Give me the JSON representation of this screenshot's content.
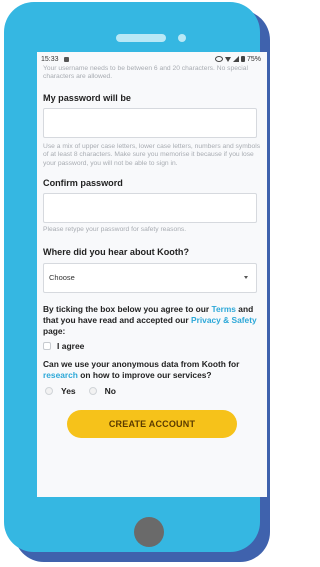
{
  "status_bar": {
    "time": "15:33",
    "battery": "75%"
  },
  "form": {
    "username_hint": "Your username needs to be between 6 and 20 characters. No special characters are allowed.",
    "password_label": "My password will be",
    "password_hint": "Use a mix of upper case letters, lower case letters, numbers and symbols of at least 8 characters. Make sure you memorise it because if you lose your password, you will not be able to sign in.",
    "confirm_label": "Confirm password",
    "confirm_hint": "Please retype your password for safety reasons.",
    "hear_label": "Where did you hear about Kooth?",
    "hear_select_value": "Choose",
    "terms_text_1": "By ticking the box below you agree to our ",
    "terms_link": "Terms",
    "terms_text_2": " and that you have read and accepted our ",
    "privacy_link": "Privacy & Safety",
    "terms_text_3": " page:",
    "agree_label": "I agree",
    "data_text_1": "Can we use your anonymous data from Kooth for ",
    "research_link": "research",
    "data_text_2": " on how to improve our services?",
    "yes_label": "Yes",
    "no_label": "No",
    "create_button": "CREATE ACCOUNT"
  },
  "colors": {
    "phone": "#35b7e2",
    "phone_shadow": "#3f62ad",
    "link": "#2da8d8",
    "button": "#f6c21a"
  }
}
